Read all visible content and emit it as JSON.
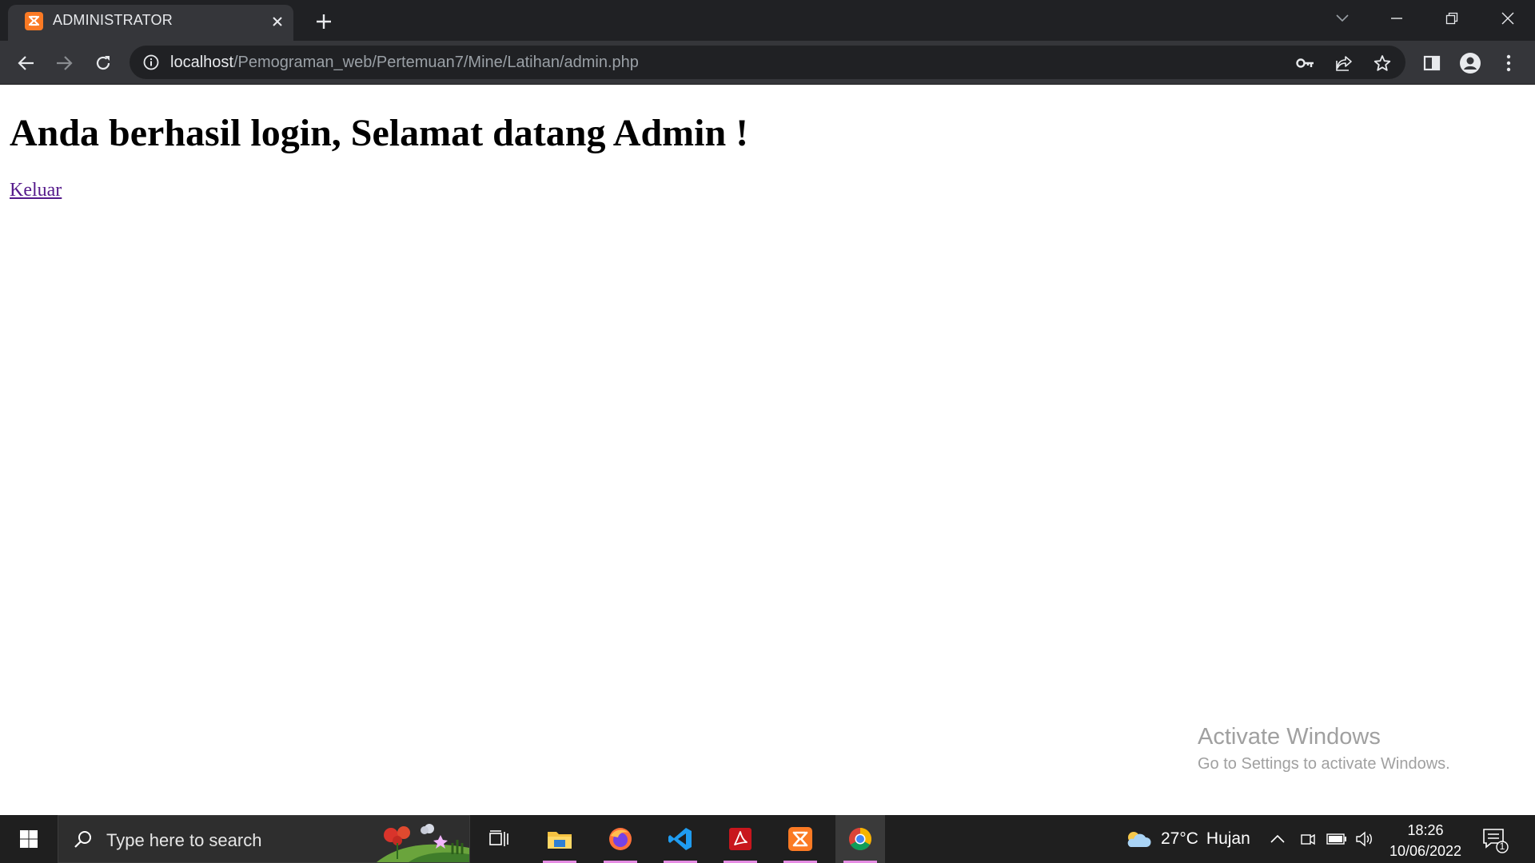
{
  "browser": {
    "tab": {
      "title": "ADMINISTRATOR",
      "favicon": "xampp-icon"
    },
    "url": {
      "host": "localhost",
      "path": "/Pemograman_web/Pertemuan7/Mine/Latihan/admin.php"
    },
    "colors": {
      "frame": "#202124",
      "toolbar": "#35363a",
      "accent_favicon": "#fb7a24"
    }
  },
  "page": {
    "heading": "Anda berhasil login, Selamat datang Admin !",
    "logout_link": "Keluar",
    "link_color": "#551a8b"
  },
  "watermark": {
    "title": "Activate Windows",
    "subtitle": "Go to Settings to activate Windows."
  },
  "taskbar": {
    "search_placeholder": "Type here to search",
    "apps": [
      "task-view",
      "file-explorer",
      "firefox",
      "vscode",
      "acrobat",
      "xampp",
      "chrome"
    ],
    "active_app": "chrome",
    "weather": {
      "temp": "27°C",
      "condition": "Hujan"
    },
    "clock": {
      "time": "18:26",
      "date": "10/06/2022"
    },
    "notification_count": "1"
  }
}
